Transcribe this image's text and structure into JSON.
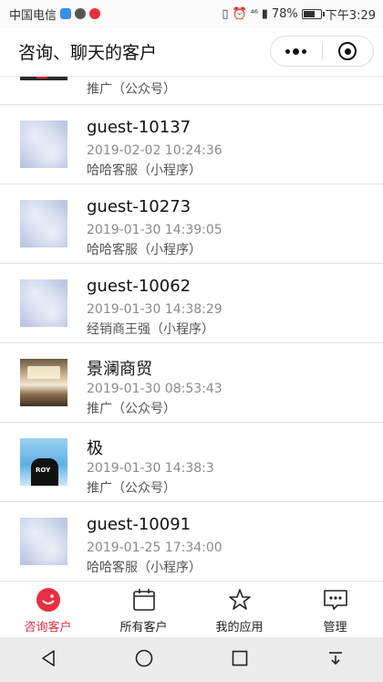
{
  "status_bar": {
    "carrier": "中国电信",
    "signal": "⁴⁶",
    "battery_percent": "78%",
    "time": "下午3:29"
  },
  "header": {
    "title": "咨询、聊天的客户"
  },
  "customers": [
    {
      "name": "",
      "time": "",
      "source": "推广（公众号）",
      "avatar": "dark-photo"
    },
    {
      "name": "guest-10137",
      "time": "2019-02-02 10:24:36",
      "source": "哈哈客服（小程序）",
      "avatar": "blurred-default"
    },
    {
      "name": "guest-10273",
      "time": "2019-01-30 14:39:05",
      "source": "哈哈客服（小程序）",
      "avatar": "blurred-default"
    },
    {
      "name": "guest-10062",
      "time": "2019-01-30 14:38:29",
      "source": "经销商王强（小程序）",
      "avatar": "blurred-default"
    },
    {
      "name": "景澜商贸",
      "time": "2019-01-30 08:53:43",
      "source": "推广（公众号）",
      "avatar": "room-photo"
    },
    {
      "name": "极",
      "time": "2019-01-30 14:38:3",
      "source": "推广（公众号）",
      "avatar": "sky-photo",
      "avatar_text": "ROY"
    },
    {
      "name": "guest-10091",
      "time": "2019-01-25 17:34:00",
      "source": "哈哈客服（小程序）",
      "avatar": "blurred-default"
    }
  ],
  "tabbar": {
    "tabs": [
      {
        "label": "咨询客户",
        "icon": "chat-smile-icon",
        "active": true
      },
      {
        "label": "所有客户",
        "icon": "calendar-icon",
        "active": false
      },
      {
        "label": "我的应用",
        "icon": "star-icon",
        "active": false
      },
      {
        "label": "管理",
        "icon": "message-dots-icon",
        "active": false
      }
    ]
  },
  "colors": {
    "accent": "#e6303f",
    "background": "#f4f4f4"
  }
}
